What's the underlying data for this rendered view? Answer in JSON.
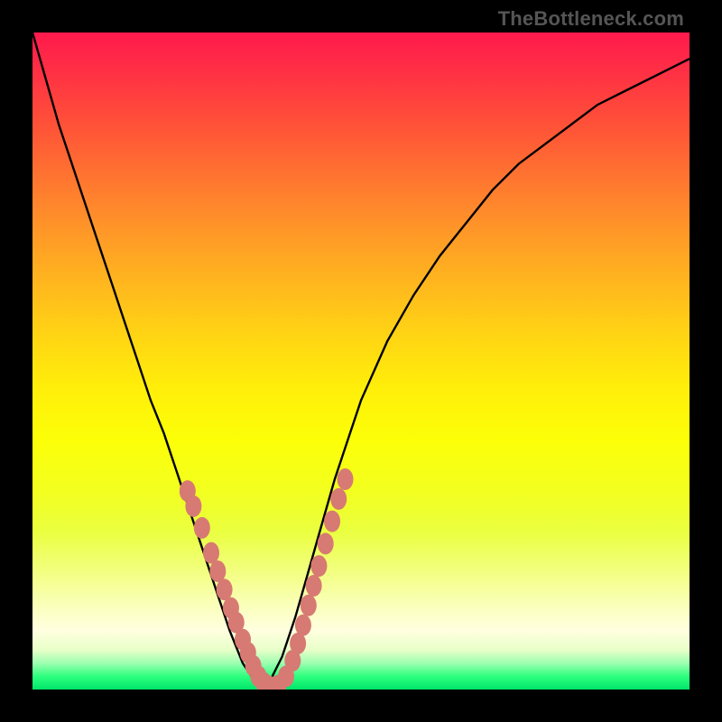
{
  "attribution": "TheBottleneck.com",
  "colors": {
    "curve": "#000000",
    "marker": "#d77a73"
  },
  "chart_data": {
    "type": "line",
    "title": "",
    "xlabel": "",
    "ylabel": "",
    "xlim": [
      0,
      1
    ],
    "ylim": [
      0,
      1
    ],
    "legend": false,
    "grid": false,
    "series": [
      {
        "name": "bottleneck-curve",
        "x": [
          0.0,
          0.02,
          0.04,
          0.06,
          0.08,
          0.1,
          0.12,
          0.14,
          0.16,
          0.18,
          0.2,
          0.22,
          0.24,
          0.26,
          0.28,
          0.3,
          0.32,
          0.34,
          0.352,
          0.36,
          0.38,
          0.4,
          0.42,
          0.44,
          0.46,
          0.48,
          0.5,
          0.54,
          0.58,
          0.62,
          0.66,
          0.7,
          0.74,
          0.78,
          0.82,
          0.86,
          0.9,
          0.94,
          0.98,
          1.0
        ],
        "y": [
          1.0,
          0.93,
          0.86,
          0.8,
          0.74,
          0.68,
          0.62,
          0.56,
          0.5,
          0.44,
          0.39,
          0.33,
          0.27,
          0.21,
          0.15,
          0.09,
          0.04,
          0.01,
          0.0,
          0.01,
          0.05,
          0.11,
          0.18,
          0.25,
          0.32,
          0.38,
          0.44,
          0.53,
          0.6,
          0.66,
          0.71,
          0.76,
          0.8,
          0.83,
          0.86,
          0.89,
          0.91,
          0.93,
          0.95,
          0.96
        ]
      }
    ],
    "markers": {
      "name": "highlight-dots",
      "points": [
        {
          "x": 0.236,
          "y": 0.302
        },
        {
          "x": 0.245,
          "y": 0.279
        },
        {
          "x": 0.258,
          "y": 0.246
        },
        {
          "x": 0.272,
          "y": 0.208
        },
        {
          "x": 0.282,
          "y": 0.18
        },
        {
          "x": 0.292,
          "y": 0.152
        },
        {
          "x": 0.302,
          "y": 0.124
        },
        {
          "x": 0.31,
          "y": 0.102
        },
        {
          "x": 0.32,
          "y": 0.076
        },
        {
          "x": 0.328,
          "y": 0.056
        },
        {
          "x": 0.336,
          "y": 0.036
        },
        {
          "x": 0.344,
          "y": 0.02
        },
        {
          "x": 0.352,
          "y": 0.01
        },
        {
          "x": 0.362,
          "y": 0.004
        },
        {
          "x": 0.374,
          "y": 0.006
        },
        {
          "x": 0.386,
          "y": 0.02
        },
        {
          "x": 0.396,
          "y": 0.044
        },
        {
          "x": 0.404,
          "y": 0.07
        },
        {
          "x": 0.412,
          "y": 0.098
        },
        {
          "x": 0.42,
          "y": 0.128
        },
        {
          "x": 0.428,
          "y": 0.158
        },
        {
          "x": 0.436,
          "y": 0.188
        },
        {
          "x": 0.446,
          "y": 0.222
        },
        {
          "x": 0.456,
          "y": 0.256
        },
        {
          "x": 0.466,
          "y": 0.29
        },
        {
          "x": 0.476,
          "y": 0.32
        }
      ]
    }
  }
}
